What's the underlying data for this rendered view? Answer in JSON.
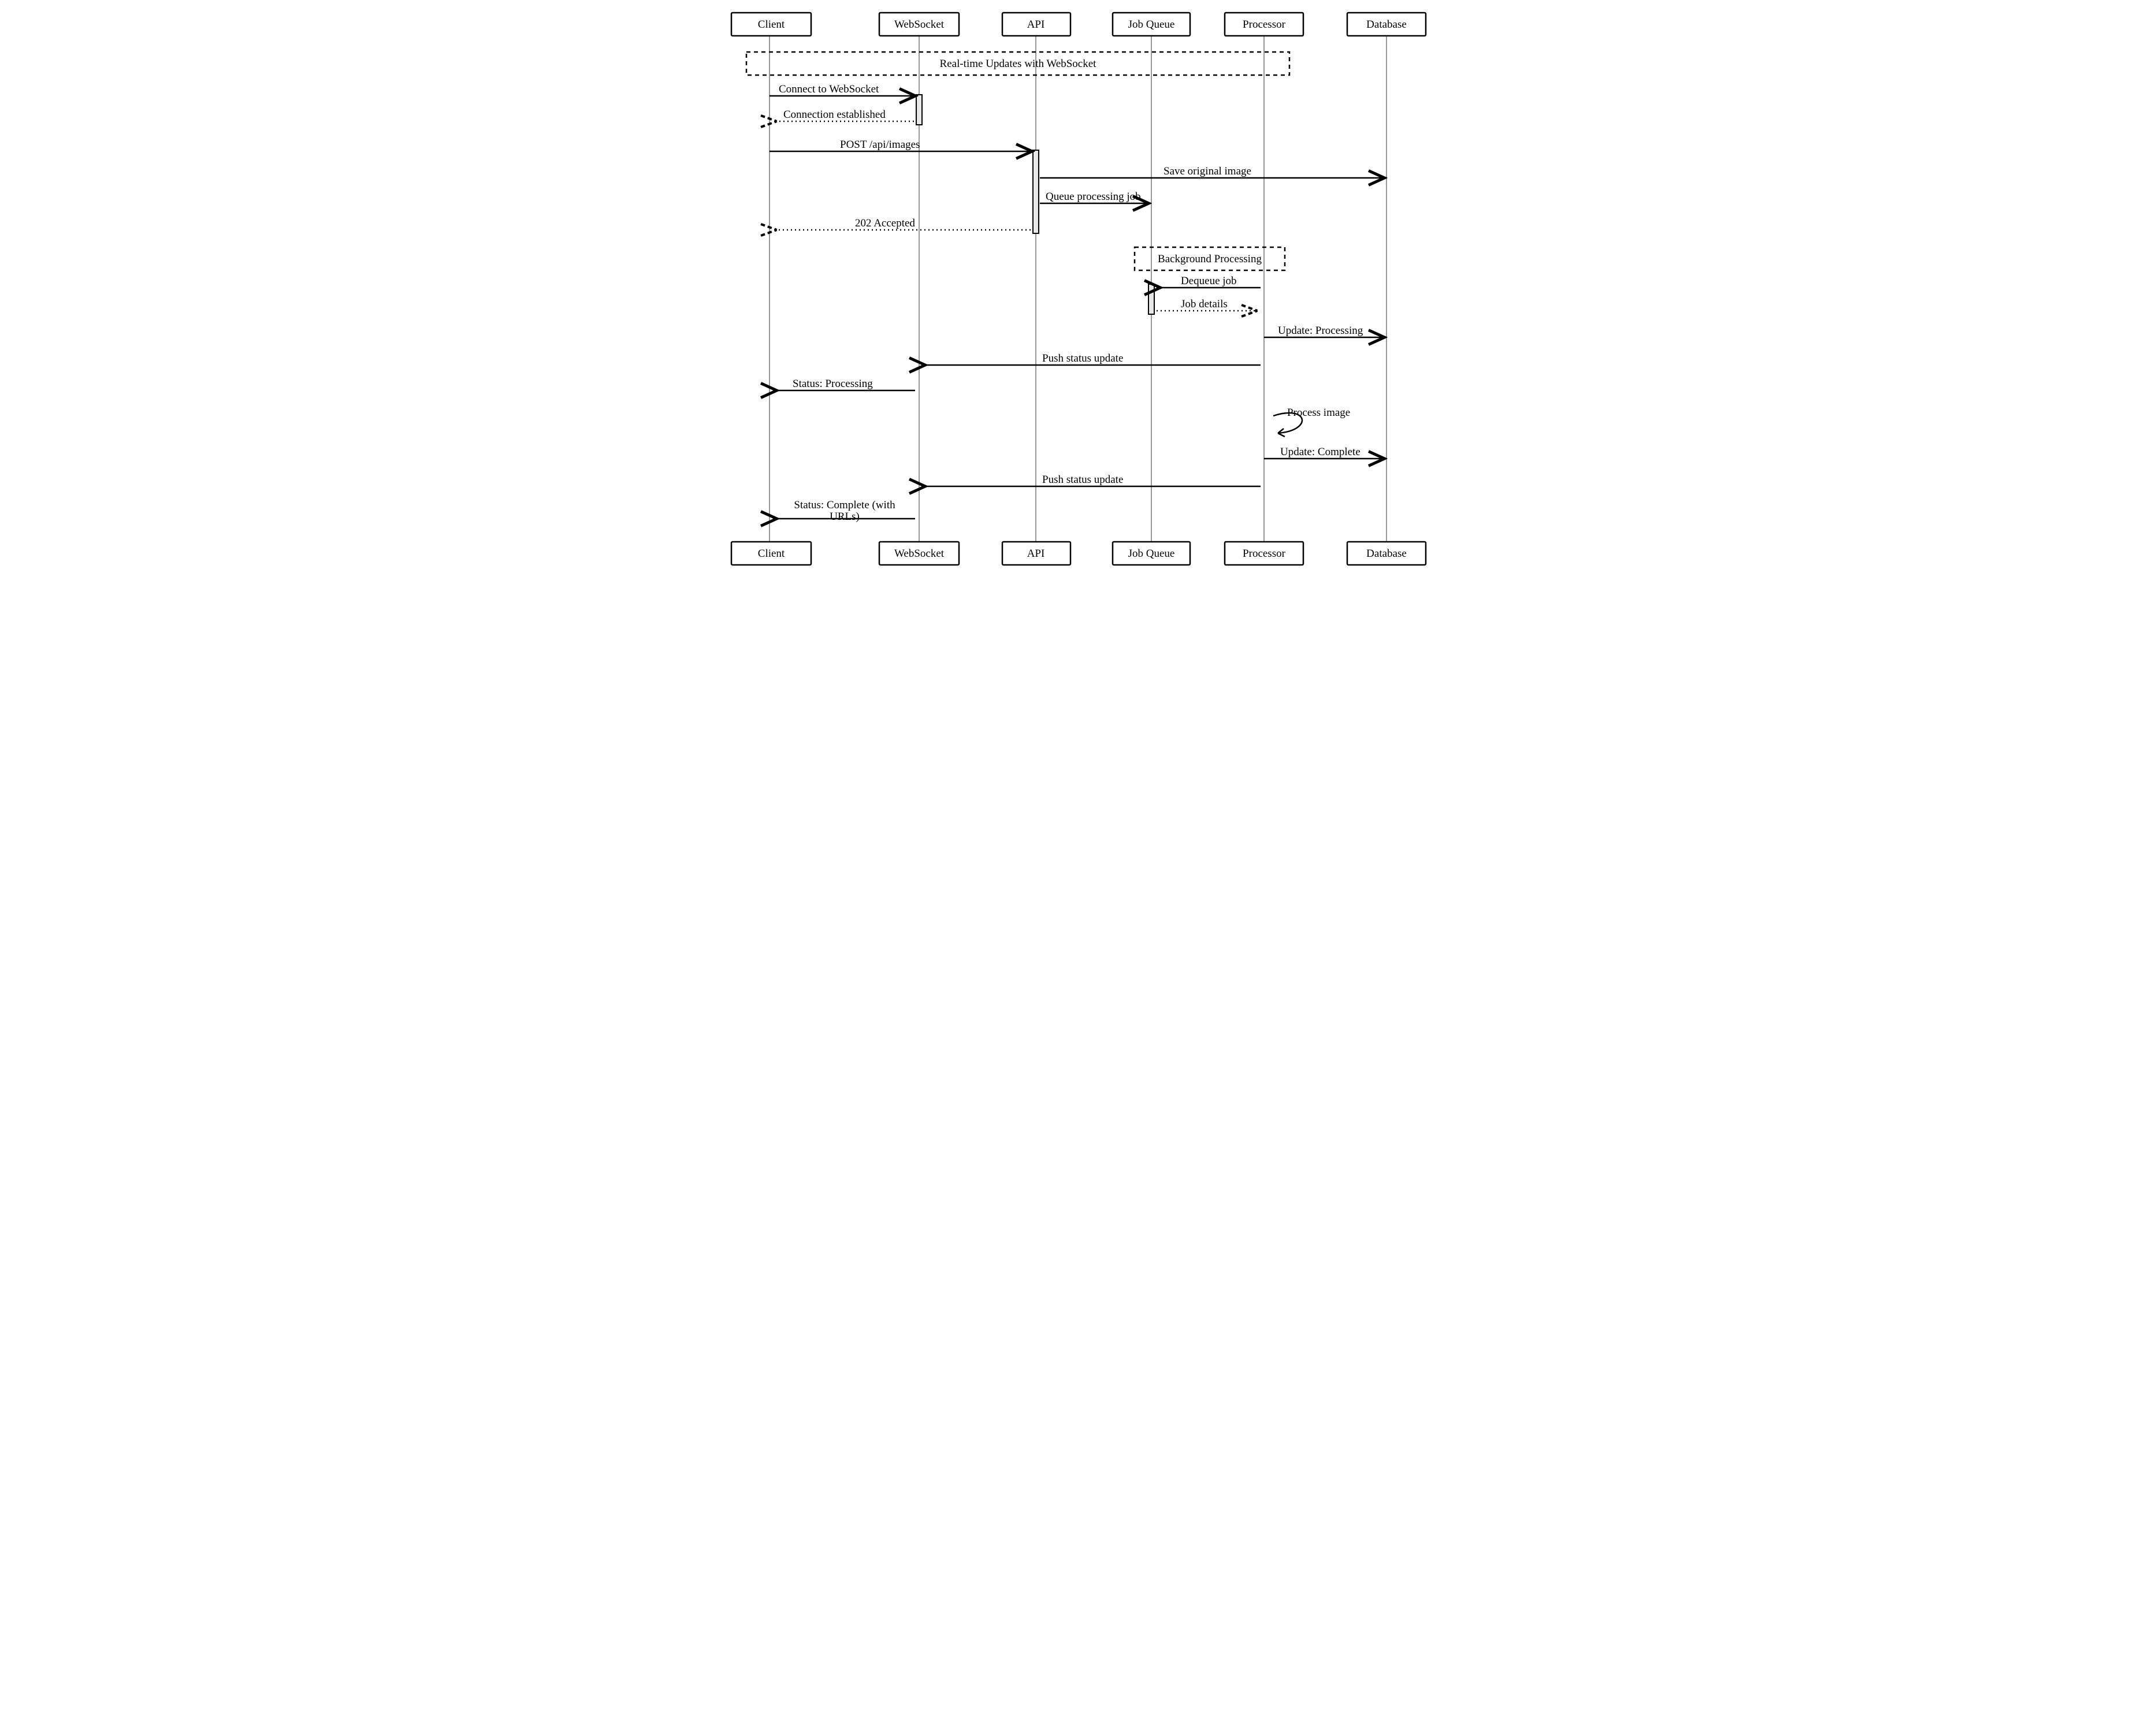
{
  "participants": [
    "Client",
    "WebSocket",
    "API",
    "Job Queue",
    "Processor",
    "Database"
  ],
  "note_realtime": "Real-time Updates with WebSocket",
  "note_background": "Background Processing",
  "msg": {
    "connect": "Connect to WebSocket",
    "connected": "Connection established",
    "post": "POST /api/images",
    "save": "Save original image",
    "queue": "Queue processing job",
    "accepted": "202 Accepted",
    "dequeue": "Dequeue job",
    "jobdetails": "Job details",
    "upd_proc": "Update: Processing",
    "push1": "Push status update",
    "stat_proc": "Status: Processing",
    "self": "Process image",
    "upd_comp": "Update: Complete",
    "push2": "Push status update",
    "stat_comp1": "Status: Complete (with",
    "stat_comp2": "URLs)"
  }
}
